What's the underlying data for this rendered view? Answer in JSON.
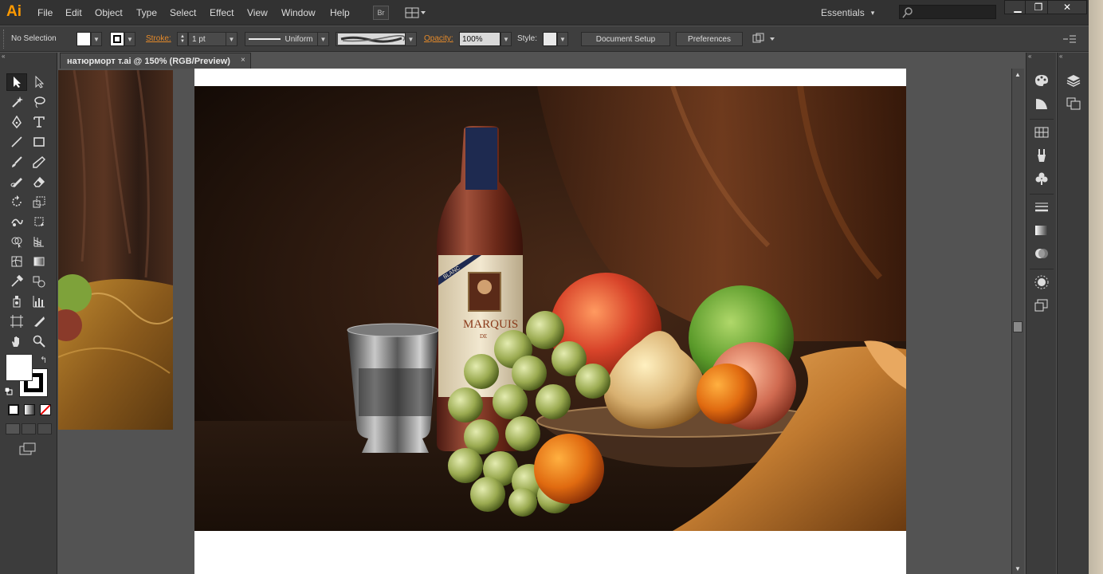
{
  "app": {
    "logo": "Ai"
  },
  "menu": [
    "File",
    "Edit",
    "Object",
    "Type",
    "Select",
    "Effect",
    "View",
    "Window",
    "Help"
  ],
  "menubar": {
    "bridge_label": "Br",
    "workspace": "Essentials",
    "workspace_arrow": "▾",
    "minimize": "▁",
    "restore": "❐",
    "close": "✕"
  },
  "control": {
    "selection": "No Selection",
    "stroke_label": "Stroke:",
    "stroke_value": "1 pt",
    "profile": "Uniform",
    "opacity_label": "Opacity:",
    "opacity_value": "100%",
    "style_label": "Style:",
    "document_setup": "Document Setup",
    "preferences": "Preferences"
  },
  "document": {
    "tab_title": "натюрморт т.ai @ 150% (RGB/Preview)",
    "tab_close": "×"
  },
  "artwork": {
    "label_brand": "MARQUIS",
    "label_sub": "DE",
    "label_ribbon": "BLANC"
  },
  "icons": {
    "tools": [
      "selection-icon",
      "direct-selection-icon",
      "magic-wand-icon",
      "lasso-icon",
      "pen-icon",
      "type-icon",
      "line-icon",
      "rectangle-icon",
      "paintbrush-icon",
      "pencil-icon",
      "blob-brush-icon",
      "eraser-icon",
      "rotate-icon",
      "scale-icon",
      "warp-icon",
      "free-transform-icon",
      "shape-builder-icon",
      "perspective-grid-icon",
      "mesh-icon",
      "gradient-icon",
      "eyedropper-icon",
      "blend-icon",
      "symbol-sprayer-icon",
      "column-graph-icon",
      "artboard-icon",
      "slice-icon",
      "hand-icon",
      "zoom-icon"
    ]
  },
  "colors": {
    "accent": "#ff9a00",
    "stroke_label": "#e58a2a",
    "ui_dark": "#323232",
    "ui_panel": "#3c3c3c",
    "canvas": "#535353"
  }
}
